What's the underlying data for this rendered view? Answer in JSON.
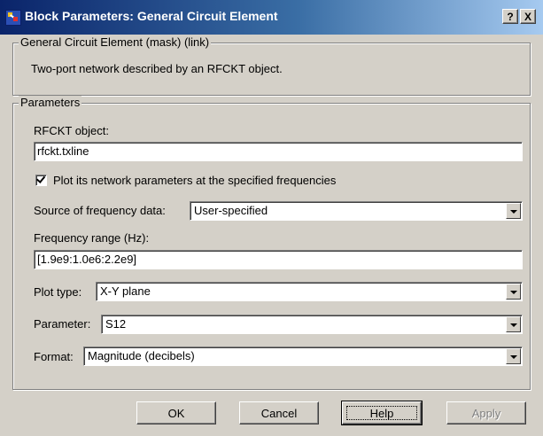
{
  "window": {
    "title": "Block Parameters: General  Circuit Element",
    "help_button": "?",
    "close_button": "X"
  },
  "description_group": {
    "title": "General Circuit Element (mask) (link)",
    "text": "Two-port network described by an RFCKT object."
  },
  "parameters_group": {
    "title": "Parameters",
    "rfckt_label": "RFCKT object:",
    "rfckt_value": "rfckt.txline",
    "plot_checkbox_label": "Plot its network parameters at the specified frequencies",
    "plot_checked": true,
    "source_label": "Source of frequency data:",
    "source_value": "User-specified",
    "freq_label": "Frequency range (Hz):",
    "freq_value": "[1.9e9:1.0e6:2.2e9]",
    "plot_type_label": "Plot type:",
    "plot_type_value": "X-Y plane",
    "parameter_label": "Parameter:",
    "parameter_value": "S12",
    "format_label": "Format:",
    "format_value": "Magnitude (decibels)"
  },
  "buttons": {
    "ok": "OK",
    "cancel": "Cancel",
    "help": "Help",
    "apply": "Apply"
  },
  "colors": {
    "dialog_bg": "#d4d0c8",
    "titlebar_start": "#0a246a",
    "titlebar_end": "#a6caf0"
  }
}
